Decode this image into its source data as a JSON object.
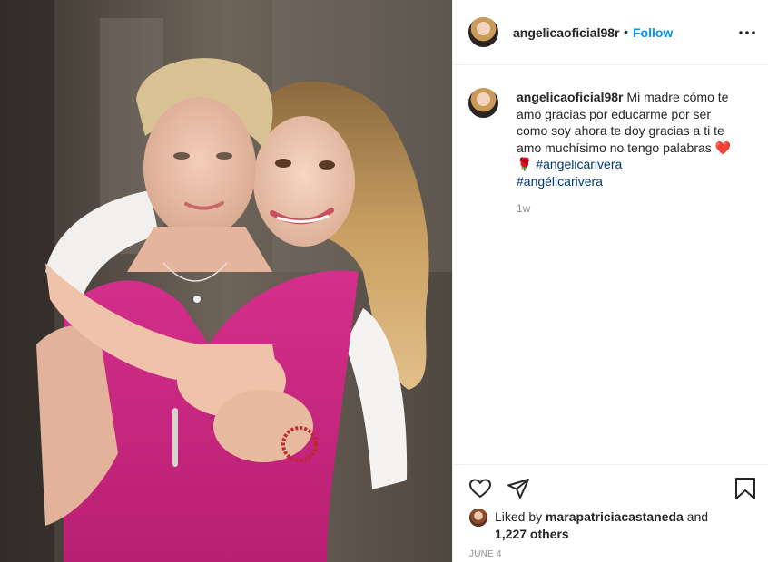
{
  "post": {
    "author": "angelicaoficial98r",
    "separator": "•",
    "follow_label": "Follow",
    "more_icon": "more-horizontal-icon"
  },
  "caption": {
    "username": "angelicaoficial98r",
    "text": "Mi madre cómo te amo gracias por educarme por ser como soy ahora te doy gracias a ti te amo muchísimo no tengo palabras",
    "emojis": "❤️🌹",
    "hashtags": [
      "#angelicarivera",
      "#angélicarivera"
    ],
    "time_ago": "1w"
  },
  "actions": {
    "like_icon": "heart-icon",
    "share_icon": "paper-plane-icon",
    "save_icon": "bookmark-icon"
  },
  "likes": {
    "prefix": "Liked by",
    "liker": "marapatriciacastaneda",
    "and": "and",
    "others": "1,227 others"
  },
  "date": "JUNE 4",
  "colors": {
    "link_blue": "#0095f6",
    "hashtag": "#00376b",
    "muted": "#8e8e8e",
    "dress_magenta": "#c8247f"
  }
}
